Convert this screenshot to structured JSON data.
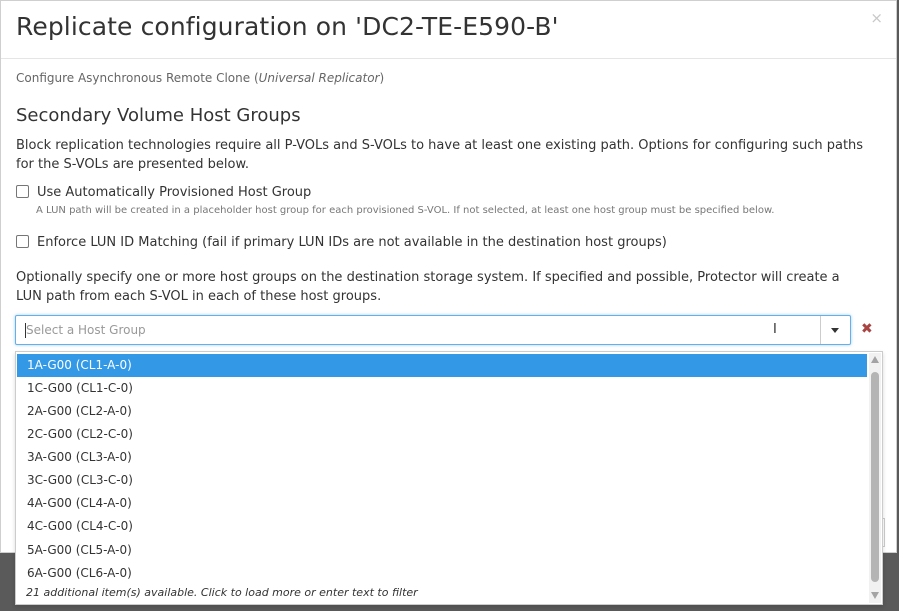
{
  "modal": {
    "title": "Replicate configuration on 'DC2-TE-E590-B'",
    "close_glyph": "×"
  },
  "subtitle": {
    "prefix": "Configure Asynchronous Remote Clone (",
    "italic": "Universal Replicator",
    "suffix": ")"
  },
  "section_title": "Secondary Volume Host Groups",
  "intro": "Block replication technologies require all P-VOLs and S-VOLs to have at least one existing path. Options for configuring such paths for the S-VOLs are presented below.",
  "options": {
    "auto_provision": {
      "label": "Use Automatically Provisioned Host Group",
      "help": "A LUN path will be created in a placeholder host group for each provisioned S-VOL. If not selected, at least one host group must be specified below.",
      "checked": false
    },
    "enforce_lun": {
      "label": "Enforce LUN ID Matching (fail if primary LUN IDs are not available in the destination host groups)",
      "checked": false
    }
  },
  "optional_text": "Optionally specify one or more host groups on the destination storage system. If specified and possible, Protector will create a LUN path from each S-VOL in each of these host groups.",
  "select": {
    "placeholder": "Select a Host Group",
    "clear_glyph": "✖"
  },
  "dropdown": {
    "items": [
      "1A-G00 (CL1-A-0)",
      "1C-G00 (CL1-C-0)",
      "2A-G00 (CL2-A-0)",
      "2C-G00 (CL2-C-0)",
      "3A-G00 (CL3-A-0)",
      "3C-G00 (CL3-C-0)",
      "4A-G00 (CL4-A-0)",
      "4C-G00 (CL4-C-0)",
      "5A-G00 (CL5-A-0)",
      "6A-G00 (CL6-A-0)"
    ],
    "highlighted_index": 0,
    "more_text": "21 additional item(s) available. Click to load more or enter text to filter"
  },
  "colors": {
    "highlight": "#3399e6",
    "focus_border": "#66afe9",
    "clear_icon": "#a94442"
  }
}
